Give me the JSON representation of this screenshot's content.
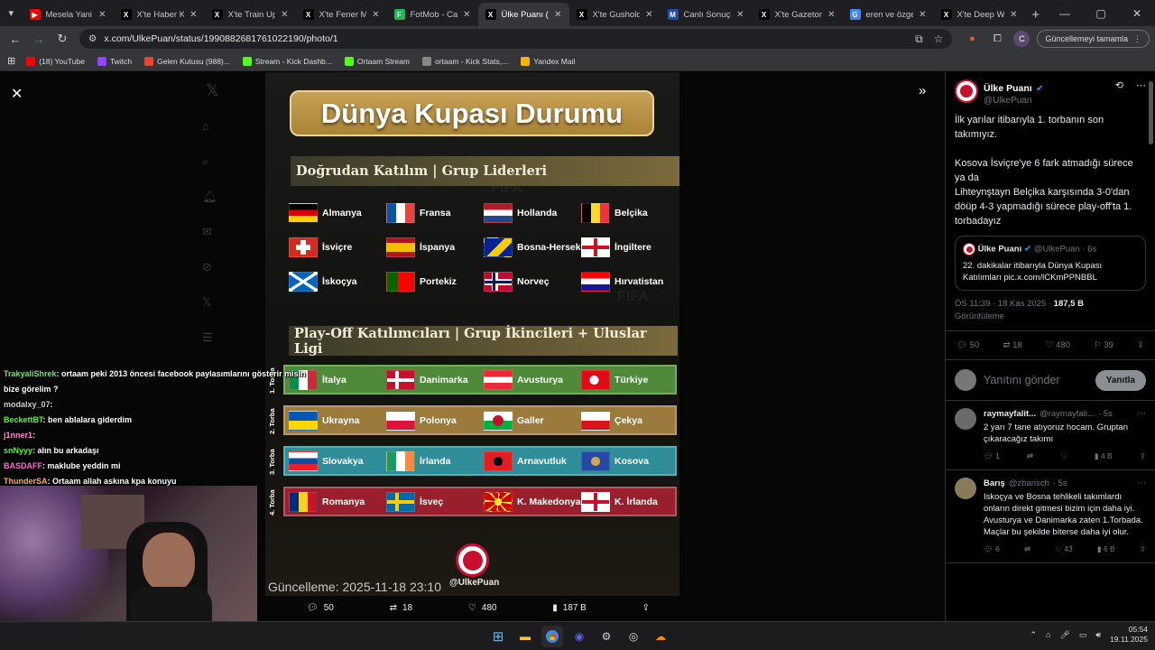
{
  "tabs": [
    {
      "title": "Mesela Yani - Y",
      "color": "#ff0000",
      "glyph": "▶"
    },
    {
      "title": "X'te Haber Kar",
      "color": "#000000",
      "glyph": "X"
    },
    {
      "title": "X'te Train Upd",
      "color": "#000000",
      "glyph": "X"
    },
    {
      "title": "X'te Fener Mar",
      "color": "#000000",
      "glyph": "X"
    },
    {
      "title": "FotMob - Canl",
      "color": "#1db954",
      "glyph": "F"
    },
    {
      "title": "Ülke Puanı (@",
      "color": "#000000",
      "glyph": "X",
      "active": true
    },
    {
      "title": "X'te Gusholder",
      "color": "#000000",
      "glyph": "X"
    },
    {
      "title": "Canlı Sonuçlar",
      "color": "#1e4fa3",
      "glyph": "M"
    },
    {
      "title": "X'te Gazetory",
      "color": "#000000",
      "glyph": "X"
    },
    {
      "title": "eren ve özge -",
      "color": "#4285f4",
      "glyph": "G"
    },
    {
      "title": "X'te Deep Web",
      "color": "#000000",
      "glyph": "X"
    }
  ],
  "address": {
    "url": "x.com/UlkePuan/status/1990882681761022190/photo/1",
    "update_label": "Güncellemeyi tamamla",
    "profile_initial": "C"
  },
  "bookmarks": [
    {
      "label": "(18) YouTube",
      "color": "#ff0000"
    },
    {
      "label": "Twitch",
      "color": "#9146ff"
    },
    {
      "label": "Gelen Kutusu (988)...",
      "color": "#ea4335"
    },
    {
      "label": "Stream - Kick Dashb...",
      "color": "#53fc18"
    },
    {
      "label": "Ortaam Stream",
      "color": "#53fc18"
    },
    {
      "label": "ortaam - Kick Stats,...",
      "color": "#888888"
    },
    {
      "label": "Yandex Mail",
      "color": "#f8b400"
    }
  ],
  "poster": {
    "title": "Dünya Kupası Durumu",
    "direct_header": "Doğrudan Katılım | Grup Liderleri",
    "direct_teams": [
      [
        "Almanya",
        "Fransa",
        "Hollanda",
        "Belçika"
      ],
      [
        "İsviçre",
        "İspanya",
        "Bosna-Hersek",
        "İngiltere"
      ],
      [
        "İskoçya",
        "Portekiz",
        "Norveç",
        "Hırvatistan"
      ]
    ],
    "playoff_header": "Play-Off Katılımcıları | Grup İkincileri + Uluslar Ligi",
    "pots": [
      {
        "label": "1. Torba",
        "color": "#4f8a3a",
        "teams": [
          "İtalya",
          "Danimarka",
          "Avusturya",
          "Türkiye"
        ]
      },
      {
        "label": "2. Torba",
        "color": "#9b7a3c",
        "teams": [
          "Ukrayna",
          "Polonya",
          "Galler",
          "Çekya"
        ]
      },
      {
        "label": "3. Torba",
        "color": "#2f8e9a",
        "teams": [
          "Slovakya",
          "İrlanda",
          "Arnavutluk",
          "Kosova"
        ]
      },
      {
        "label": "4. Torba",
        "color": "#9a1f2c",
        "teams": [
          "Romanya",
          "İsveç",
          "K. Makedonya",
          "K. İrlanda"
        ]
      }
    ],
    "updated": "Güncelleme: 2025-11-18 23:10",
    "handle": "@UlkePuan"
  },
  "photo_actions": {
    "replies": "50",
    "reposts": "18",
    "likes": "480",
    "views": "187 B"
  },
  "chat": [
    {
      "user": "TrakyaliShrek",
      "color": "#7de07d",
      "text": ": ortaam peki 2013 öncesi facebook paylasımlarını gösterir misin bize görelim ?"
    },
    {
      "user": "modalxy_07",
      "color": "#cfcfcf",
      "text": ":"
    },
    {
      "user": "BeckettBT",
      "color": "#53fc18",
      "text": ": ben ablalara giderdim"
    },
    {
      "user": "j1nner1",
      "color": "#ff8ad8",
      "text": ":"
    },
    {
      "user": "snNyyy",
      "color": "#53fc18",
      "text": ": alın bu arkadaşı"
    },
    {
      "user": "BASDAFF",
      "color": "#ff6ad5",
      "text": ": maklube yeddin mi"
    },
    {
      "user": "ThunderSA",
      "color": "#ffb347",
      "text": ": Ortaam allah askına kpa konuyu"
    }
  ],
  "side": {
    "name": "Ülke Puanı",
    "handle": "@UlkePuan",
    "text": "İlk yarılar itibarıyla 1. torbanın son takımıyız.\n\nKosova İsviçre'ye 6 fark atmadığı sürece\nya da\nLihteynştayn Belçika karşısında 3-0'dan döüp 4-3 yapmadığı sürece play-off'ta 1. torbadayız",
    "quote_name": "Ülke Puanı",
    "quote_meta": "@UlkePuan · 6s",
    "quote_text": "22. dakikalar itibarıyla Dünya Kupası Katılımları pic.x.com/lCKmPPNBBL",
    "time": "ÖS 11:39 · 18 Kas 2025 · ",
    "views": "187,5 B",
    "views_label": "Görüntüleme",
    "stats": {
      "replies": "50",
      "reposts": "18",
      "likes": "480",
      "bookmarks": "39"
    },
    "reply_placeholder": "Yanıtını gönder",
    "reply_button": "Yanıtla",
    "replies": [
      {
        "name": "raymayfalit...",
        "handle": "@raymayfali...",
        "time": "· 5s",
        "text": "2 yarı 7 tane atıyoruz hocam. Gruptan çıkaracağız takımı",
        "r": "1",
        "l": "",
        "v": "4 B",
        "color": "#6b6b6b"
      },
      {
        "name": "Barış",
        "handle": "@zbarisch",
        "time": "· 5s",
        "text": "Iskoçya ve Bosna tehlikeli takımlardı onların direkt gitmesi bizim için daha iyi. Avusturya ve Danimarka zaten 1.Torbada. Maçlar bu şekilde biterse daha iyi olur.",
        "r": "6",
        "l": "43",
        "v": "6 B",
        "color": "#8a7a5a"
      }
    ]
  },
  "clock": {
    "time": "05:54",
    "date": "19.11.2025"
  }
}
